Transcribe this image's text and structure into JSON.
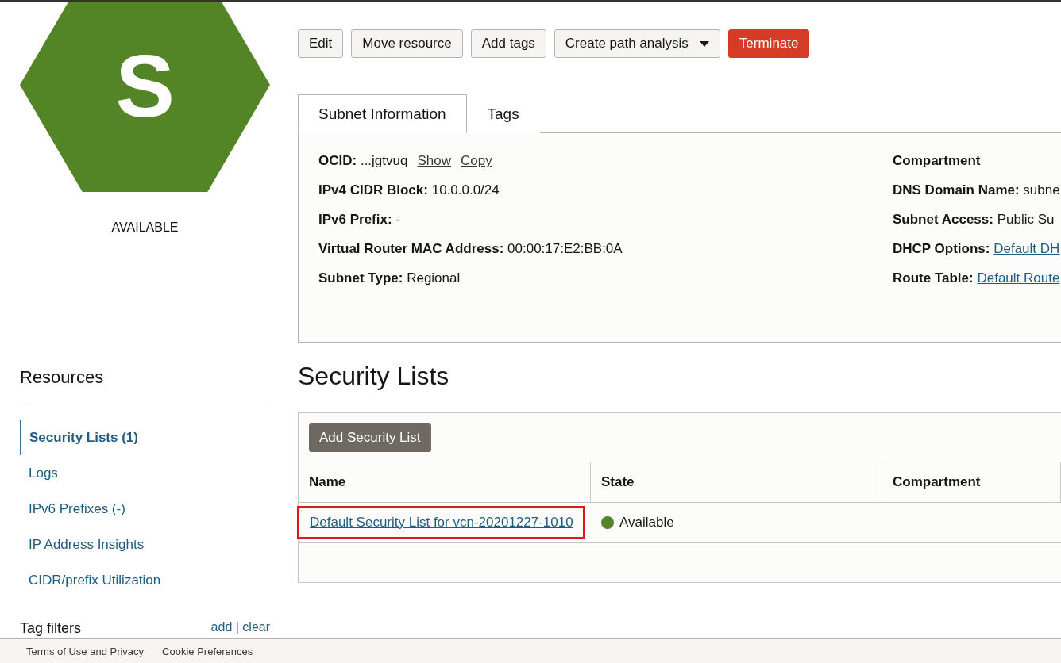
{
  "resource": {
    "letter": "S",
    "state": "AVAILABLE",
    "color": "#538527"
  },
  "actions": [
    {
      "label": "Edit",
      "kind": "plain"
    },
    {
      "label": "Move resource",
      "kind": "plain"
    },
    {
      "label": "Add tags",
      "kind": "plain"
    },
    {
      "label": "Create path analysis",
      "kind": "menu"
    },
    {
      "label": "Terminate",
      "kind": "danger"
    }
  ],
  "tabs": [
    {
      "label": "Subnet Information",
      "selected": true
    },
    {
      "label": "Tags",
      "selected": false
    }
  ],
  "details_left": [
    {
      "label": "OCID:",
      "value": "...jgtvuq",
      "links": [
        "Show",
        "Copy"
      ]
    },
    {
      "label": "IPv4 CIDR Block:",
      "value": "10.0.0.0/24"
    },
    {
      "label": "IPv6 Prefix:",
      "value": "-"
    },
    {
      "label": "Virtual Router MAC Address:",
      "value": "00:00:17:E2:BB:0A"
    },
    {
      "label": "Subnet Type:",
      "value": "Regional"
    }
  ],
  "details_right": [
    {
      "label": "Compartment"
    },
    {
      "label": "DNS Domain Name:",
      "value": "subne"
    },
    {
      "label": "Subnet Access:",
      "value": "Public Su"
    },
    {
      "label": "DHCP Options:",
      "link": "Default DH"
    },
    {
      "label": "Route Table:",
      "link": "Default Route"
    }
  ],
  "sidebar": {
    "title": "Resources",
    "items": [
      {
        "label": "Security Lists (1)",
        "selected": true
      },
      {
        "label": "Logs",
        "selected": false
      },
      {
        "label": "IPv6 Prefixes (-)",
        "selected": false
      },
      {
        "label": "IP Address Insights",
        "selected": false
      },
      {
        "label": "CIDR/prefix Utilization",
        "selected": false
      }
    ],
    "tag_filters": {
      "title": "Tag filters",
      "actions": "add | clear"
    }
  },
  "section": {
    "title": "Security Lists",
    "add_button": "Add Security List",
    "columns": [
      "Name",
      "State",
      "Compartment"
    ],
    "rows": [
      {
        "name": "Default Security List for vcn-20201227-1010",
        "highlighted": true,
        "state": "Available",
        "color": "#538527"
      }
    ]
  },
  "footer": {
    "links": [
      "Terms of Use and Privacy",
      "Cookie Preferences"
    ]
  }
}
